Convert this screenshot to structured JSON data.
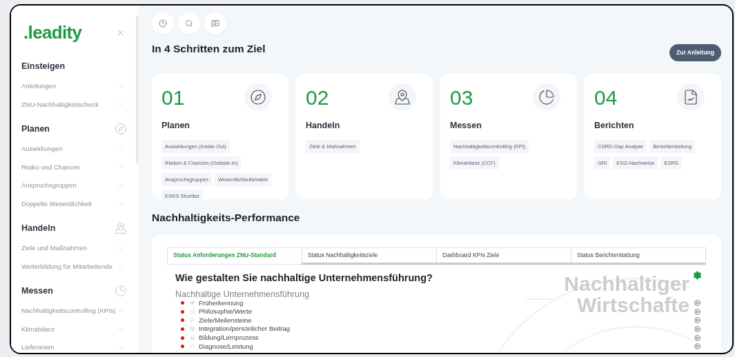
{
  "sidebar": {
    "logo": ".leadity",
    "sections": [
      {
        "title": "Einsteigen",
        "items": [
          {
            "label": "Anleitungen"
          },
          {
            "label": "ZNU-Nachhaltigkeitscheck"
          }
        ]
      },
      {
        "title": "Planen",
        "items": [
          {
            "label": "Auswirkungen"
          },
          {
            "label": "Risiko und Chancen"
          },
          {
            "label": "Anspruchsgruppen"
          },
          {
            "label": "Doppelte Wesentlichkeit"
          }
        ]
      },
      {
        "title": "Handeln",
        "items": [
          {
            "label": "Ziele und Maßnahmen"
          },
          {
            "label": "Weiterbildung für Mitarbeitende"
          }
        ]
      },
      {
        "title": "Messen",
        "items": [
          {
            "label": "Nachhaltigkeitscontrolling (KPIs)"
          },
          {
            "label": "Klimabilanz"
          },
          {
            "label": "Lieferanten"
          }
        ]
      }
    ]
  },
  "steps_section": {
    "title": "In 4 Schritten zum Ziel",
    "button": "Zur Anleitung",
    "cards": [
      {
        "number": "01",
        "title": "Planen",
        "tags": [
          "Auswirkungen (Inside-Out)",
          "Risiken & Chancen (Outside-In)",
          "Anspruchsgruppen",
          "Wesentlichkeitsmatrix",
          "ESRS Shortlist"
        ]
      },
      {
        "number": "02",
        "title": "Handeln",
        "tags": [
          "Ziele & Maßnahmen"
        ]
      },
      {
        "number": "03",
        "title": "Messen",
        "tags": [
          "Nachhaltigkeitscontrolling (KPI)",
          "Klimabilanz (CCF)"
        ]
      },
      {
        "number": "04",
        "title": "Berichten",
        "tags": [
          "CSRD-Gap Analyse",
          "Berichterstellung",
          "GRI",
          "ESG-Nachweise",
          "ESRS"
        ]
      }
    ]
  },
  "performance": {
    "title": "Nachhaltigkeits-Performance",
    "tabs": [
      {
        "label": "Status Anforderungen ZNU-Standard",
        "selected": true
      },
      {
        "label": "Status Nachhaltigkeitsziele",
        "selected": false
      },
      {
        "label": "Dashboard KPIs Ziele",
        "selected": false
      },
      {
        "label": "Status Berichterstattung",
        "selected": false
      }
    ],
    "question": "Wie gestalten Sie nachhaltige Unternehmensführung?",
    "background_text": [
      "Nachhaltiger",
      "Wirtschafte"
    ],
    "group_title": "Nachhaltige Unternehmensführung",
    "items": [
      {
        "label": "Früherkennung",
        "color": "#e3131b"
      },
      {
        "label": "Philosophie/Werte",
        "color": "#e3131b"
      },
      {
        "label": "Ziele/Meilensteine",
        "color": "#e3131b"
      },
      {
        "label": "Integration/persönlicher Beitrag",
        "color": "#e3131b"
      },
      {
        "label": "Bildung/Lernprozess",
        "color": "#e3131b"
      },
      {
        "label": "Diagnose/Leistung",
        "color": "#e3131b"
      }
    ]
  }
}
